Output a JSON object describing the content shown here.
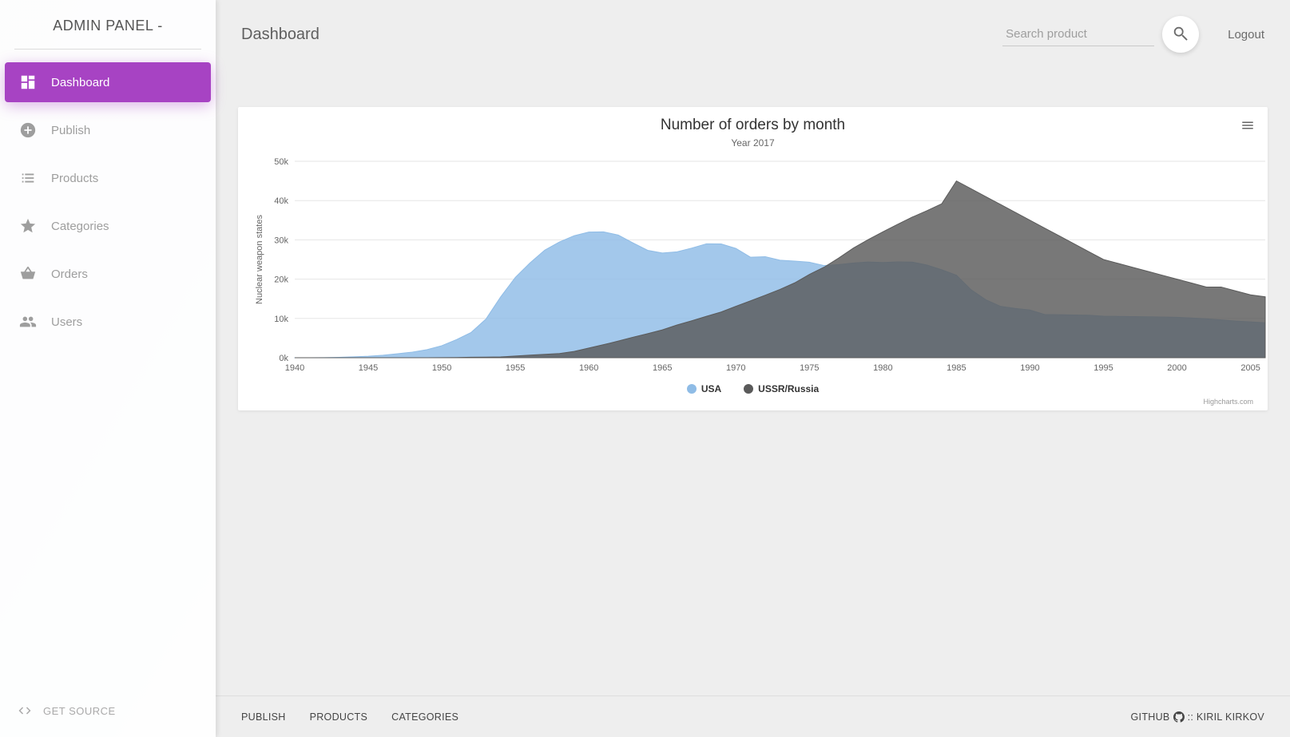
{
  "brand": "ADMIN PANEL -",
  "sidebar": {
    "items": [
      {
        "label": "Dashboard",
        "icon": "dashboard",
        "active": true
      },
      {
        "label": "Publish",
        "icon": "plus",
        "active": false
      },
      {
        "label": "Products",
        "icon": "list",
        "active": false
      },
      {
        "label": "Categories",
        "icon": "star",
        "active": false
      },
      {
        "label": "Orders",
        "icon": "basket",
        "active": false
      },
      {
        "label": "Users",
        "icon": "users",
        "active": false
      }
    ],
    "footer_label": "GET SOURCE"
  },
  "header": {
    "page_title": "Dashboard",
    "search_placeholder": "Search product",
    "logout": "Logout"
  },
  "footer": {
    "links": [
      "PUBLISH",
      "PRODUCTS",
      "CATEGORIES"
    ],
    "right_prefix": "GITHUB",
    "right_suffix": ":: KIRIL KIRKOV"
  },
  "chart_data": {
    "type": "area",
    "title": "Number of orders by month",
    "subtitle": "Year 2017",
    "ylabel": "Nuclear weapon states",
    "xlabel": "",
    "x_start": 1940,
    "x_end": 2006,
    "x_ticks": [
      1940,
      1945,
      1950,
      1955,
      1960,
      1965,
      1970,
      1975,
      1980,
      1985,
      1990,
      1995,
      2000,
      2005
    ],
    "y_ticks": [
      0,
      10000,
      20000,
      30000,
      40000,
      50000
    ],
    "y_tick_labels": [
      "0k",
      "10k",
      "20k",
      "30k",
      "40k",
      "50k"
    ],
    "ylim": [
      0,
      50000
    ],
    "credits": "Highcharts.com",
    "series": [
      {
        "name": "USA",
        "color": "#8fbce6",
        "values": [
          6,
          11,
          32,
          110,
          235,
          369,
          640,
          1005,
          1436,
          2063,
          3057,
          4618,
          6444,
          9822,
          15468,
          20434,
          24126,
          27387,
          29459,
          31056,
          31982,
          32040,
          31233,
          29224,
          27342,
          26662,
          26956,
          27912,
          28999,
          28965,
          27826,
          25579,
          25722,
          24826,
          24605,
          24304,
          23464,
          23708,
          24099,
          24357,
          24237,
          24401,
          24344,
          23586,
          22380,
          21004,
          17287,
          14747,
          13076,
          12555,
          12144,
          11009,
          10950,
          10871,
          10824,
          10577,
          10527,
          10475,
          10421,
          10358,
          10295,
          10104,
          9914,
          9620,
          9326,
          9127,
          8900
        ]
      },
      {
        "name": "USSR/Russia",
        "color": "#5a5a5a",
        "values": [
          0,
          0,
          0,
          0,
          0,
          0,
          0,
          0,
          0,
          5,
          25,
          50,
          120,
          150,
          200,
          426,
          660,
          869,
          1060,
          1605,
          2471,
          3322,
          4238,
          5221,
          6129,
          7089,
          8339,
          9399,
          10538,
          11643,
          13092,
          14478,
          15915,
          17385,
          19055,
          21205,
          23044,
          25393,
          27935,
          30062,
          32049,
          33952,
          35804,
          37431,
          39197,
          45000,
          43000,
          41000,
          39000,
          37000,
          35000,
          33000,
          31000,
          29000,
          27000,
          25000,
          24000,
          23000,
          22000,
          21000,
          20000,
          19000,
          18000,
          18000,
          17000,
          16000,
          15500
        ]
      }
    ]
  }
}
